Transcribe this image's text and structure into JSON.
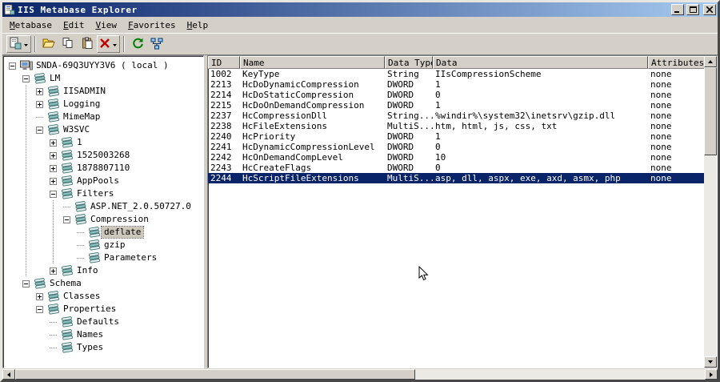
{
  "window": {
    "title": "IIS Metabase Explorer"
  },
  "menu": {
    "items": [
      {
        "label": "Metabase"
      },
      {
        "label": "Edit"
      },
      {
        "label": "View"
      },
      {
        "label": "Favorites"
      },
      {
        "label": "Help"
      }
    ]
  },
  "toolbar": {
    "buttons": [
      {
        "name": "new-key",
        "icon": "new",
        "dropdown": true
      },
      {
        "separator": true
      },
      {
        "name": "open",
        "icon": "open"
      },
      {
        "name": "copy",
        "icon": "copy"
      },
      {
        "name": "paste",
        "icon": "paste"
      },
      {
        "name": "delete",
        "icon": "delete",
        "dropdown": true
      },
      {
        "separator": true
      },
      {
        "name": "refresh",
        "icon": "refresh"
      },
      {
        "name": "connect",
        "icon": "connect"
      }
    ]
  },
  "tree": {
    "items": [
      {
        "label": "SNDA-69Q3UYY3V6 ( local )",
        "depth": 0,
        "expand": "minus",
        "icon": "computer",
        "selected": false
      },
      {
        "label": "LM",
        "depth": 1,
        "expand": "minus",
        "icon": "db",
        "selected": false
      },
      {
        "label": "IISADMIN",
        "depth": 2,
        "expand": "plus",
        "icon": "db",
        "selected": false
      },
      {
        "label": "Logging",
        "depth": 2,
        "expand": "plus",
        "icon": "db",
        "selected": false
      },
      {
        "label": "MimeMap",
        "depth": 2,
        "expand": "none",
        "icon": "db",
        "selected": false
      },
      {
        "label": "W3SVC",
        "depth": 2,
        "expand": "minus",
        "icon": "db",
        "selected": false
      },
      {
        "label": "1",
        "depth": 3,
        "expand": "plus",
        "icon": "db",
        "selected": false
      },
      {
        "label": "1525003268",
        "depth": 3,
        "expand": "plus",
        "icon": "db",
        "selected": false
      },
      {
        "label": "1878807110",
        "depth": 3,
        "expand": "plus",
        "icon": "db",
        "selected": false
      },
      {
        "label": "AppPools",
        "depth": 3,
        "expand": "plus",
        "icon": "db",
        "selected": false
      },
      {
        "label": "Filters",
        "depth": 3,
        "expand": "minus",
        "icon": "db",
        "selected": false
      },
      {
        "label": "ASP.NET_2.0.50727.0",
        "depth": 4,
        "expand": "none",
        "icon": "db",
        "selected": false
      },
      {
        "label": "Compression",
        "depth": 4,
        "expand": "minus",
        "icon": "db",
        "selected": false
      },
      {
        "label": "deflate",
        "depth": 5,
        "expand": "none",
        "icon": "db",
        "selected": true
      },
      {
        "label": "gzip",
        "depth": 5,
        "expand": "none",
        "icon": "db",
        "selected": false
      },
      {
        "label": "Parameters",
        "depth": 5,
        "expand": "none",
        "icon": "db",
        "selected": false
      },
      {
        "label": "Info",
        "depth": 3,
        "expand": "plus",
        "icon": "db",
        "selected": false
      },
      {
        "label": "Schema",
        "depth": 1,
        "expand": "minus",
        "icon": "db",
        "selected": false
      },
      {
        "label": "Classes",
        "depth": 2,
        "expand": "plus",
        "icon": "db",
        "selected": false
      },
      {
        "label": "Properties",
        "depth": 2,
        "expand": "minus",
        "icon": "db",
        "selected": false
      },
      {
        "label": "Defaults",
        "depth": 3,
        "expand": "none",
        "icon": "db",
        "selected": false
      },
      {
        "label": "Names",
        "depth": 3,
        "expand": "none",
        "icon": "db",
        "selected": false
      },
      {
        "label": "Types",
        "depth": 3,
        "expand": "none",
        "icon": "db",
        "selected": false
      }
    ]
  },
  "table": {
    "columns": [
      "ID",
      "Name",
      "Data Type",
      "Data",
      "Attributes"
    ],
    "rows": [
      [
        "1002",
        "KeyType",
        "String",
        "IIsCompressionScheme",
        "none"
      ],
      [
        "2213",
        "HcDoDynamicCompression",
        "DWORD",
        "1",
        "none"
      ],
      [
        "2214",
        "HcDoStaticCompression",
        "DWORD",
        "0",
        "none"
      ],
      [
        "2215",
        "HcDoOnDemandCompression",
        "DWORD",
        "1",
        "none"
      ],
      [
        "2237",
        "HcCompressionDll",
        "String...",
        "%windir%\\system32\\inetsrv\\gzip.dll",
        "none"
      ],
      [
        "2238",
        "HcFileExtensions",
        "MultiS...",
        "htm, html, js, css, txt",
        "none"
      ],
      [
        "2240",
        "HcPriority",
        "DWORD",
        "1",
        "none"
      ],
      [
        "2241",
        "HcDynamicCompressionLevel",
        "DWORD",
        "0",
        "none"
      ],
      [
        "2242",
        "HcOnDemandCompLevel",
        "DWORD",
        "10",
        "none"
      ],
      [
        "2243",
        "HcCreateFlags",
        "DWORD",
        "0",
        "none"
      ],
      [
        "2244",
        "HcScriptFileExtensions",
        "MultiS...",
        "asp, dll, aspx, exe, axd, asmx, php",
        "none"
      ]
    ],
    "selected_row_id": "2244"
  }
}
